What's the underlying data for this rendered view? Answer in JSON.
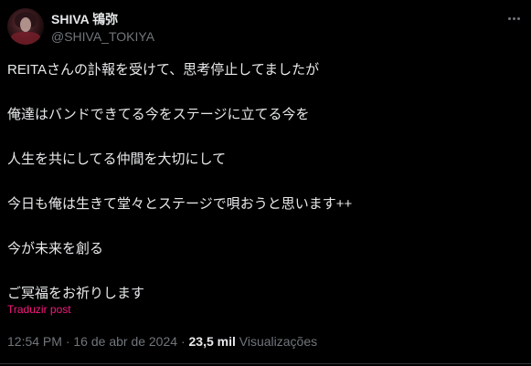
{
  "author": {
    "display_name": "SHIVA 鴇弥",
    "handle": "@SHIVA_TOKIYA"
  },
  "post": {
    "lines": [
      "REITAさんの訃報を受けて、思考停止してましたが",
      "俺達はバンドできてる今をステージに立てる今を",
      "人生を共にしてる仲間を大切にして",
      "今日も俺は生きて堂々とステージで唄おうと思います++",
      "今が未来を創る",
      "ご冥福をお祈りします"
    ],
    "translate_label": "Traduzir post"
  },
  "meta": {
    "time": "12:54 PM",
    "separator": "·",
    "date": "16 de abr de 2024",
    "views_count": "23,5 mil",
    "views_label": "Visualizações"
  },
  "icons": {
    "more": "more-horizontal-icon"
  },
  "colors": {
    "background": "#000000",
    "text_primary": "#e7e9ea",
    "text_secondary": "#71767b",
    "translate_link": "#f91880"
  }
}
